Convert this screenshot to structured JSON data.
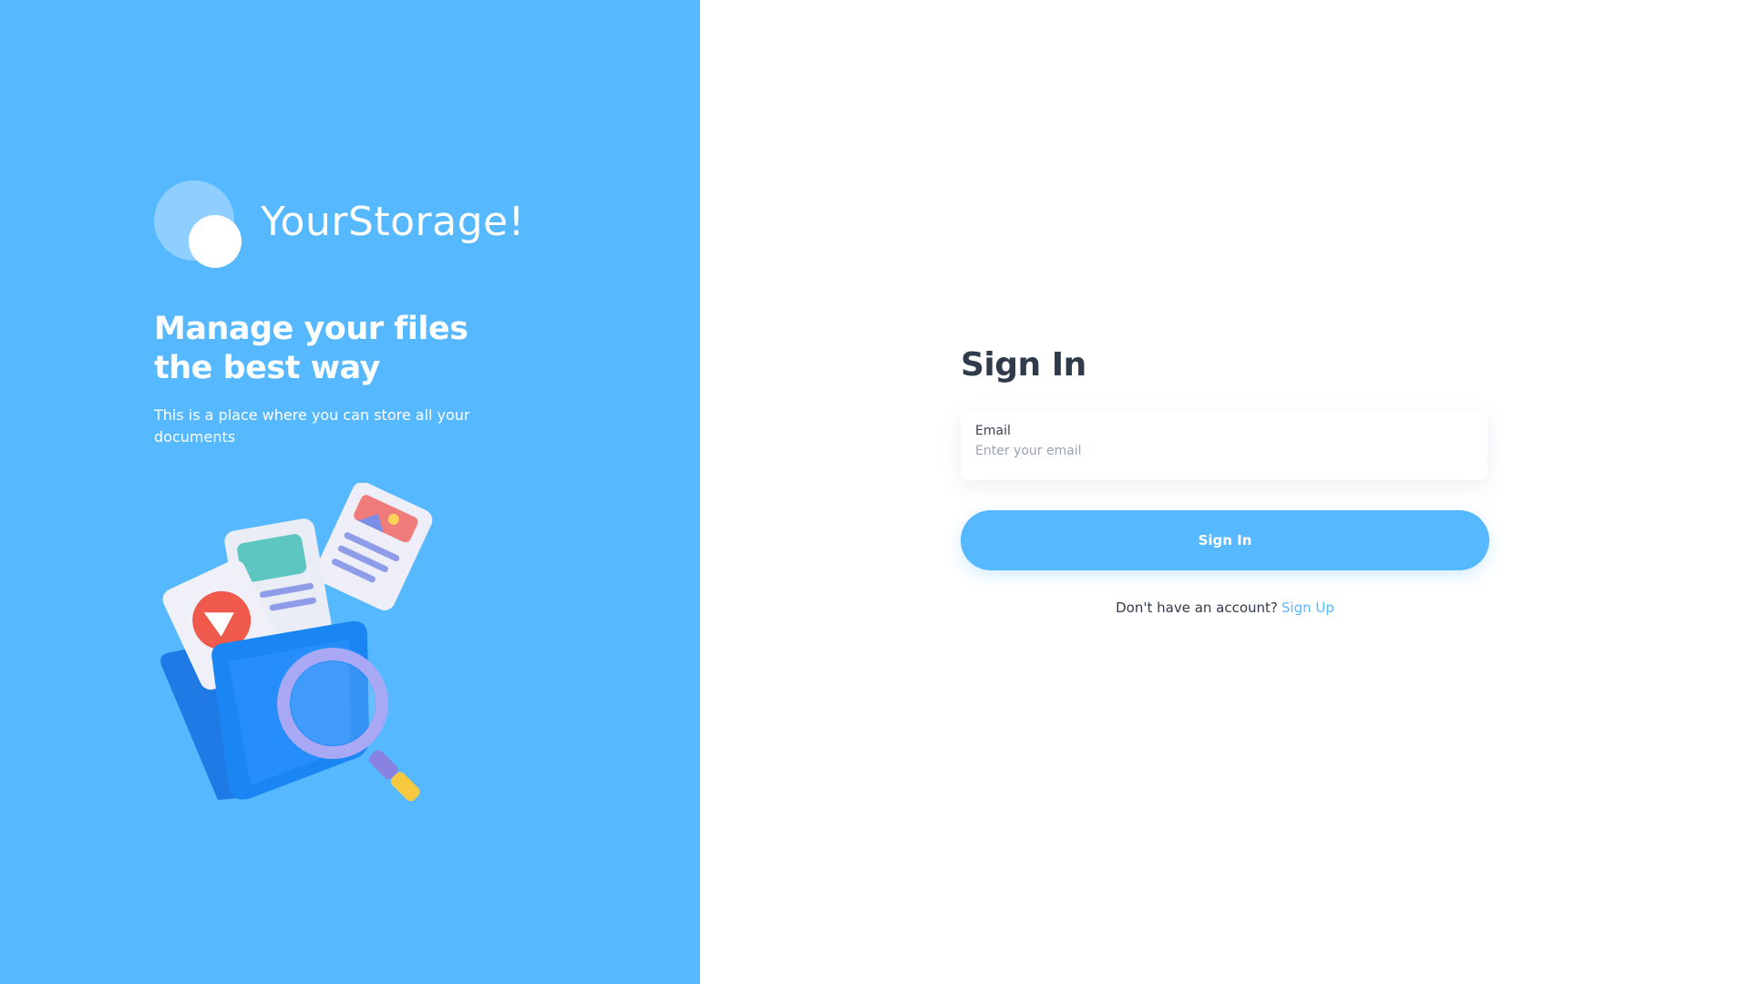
{
  "brand": {
    "name": "YourStorage!",
    "hero_title": "Manage your files the best way",
    "hero_subtitle": "This is a place where you can store all your documents"
  },
  "signin": {
    "title": "Sign In",
    "email_label": "Email",
    "email_placeholder": "Enter your email",
    "email_value": "",
    "submit_label": "Sign In",
    "no_account_text": "Don't have an account?",
    "signup_link_label": "Sign Up"
  },
  "colors": {
    "brand_blue": "#56b8ff",
    "title_dark": "#2f3a4a",
    "white": "#ffffff"
  },
  "icons": {
    "logo": "logo-circles-icon",
    "illustration": "folder-files-magnifier-illustration"
  }
}
